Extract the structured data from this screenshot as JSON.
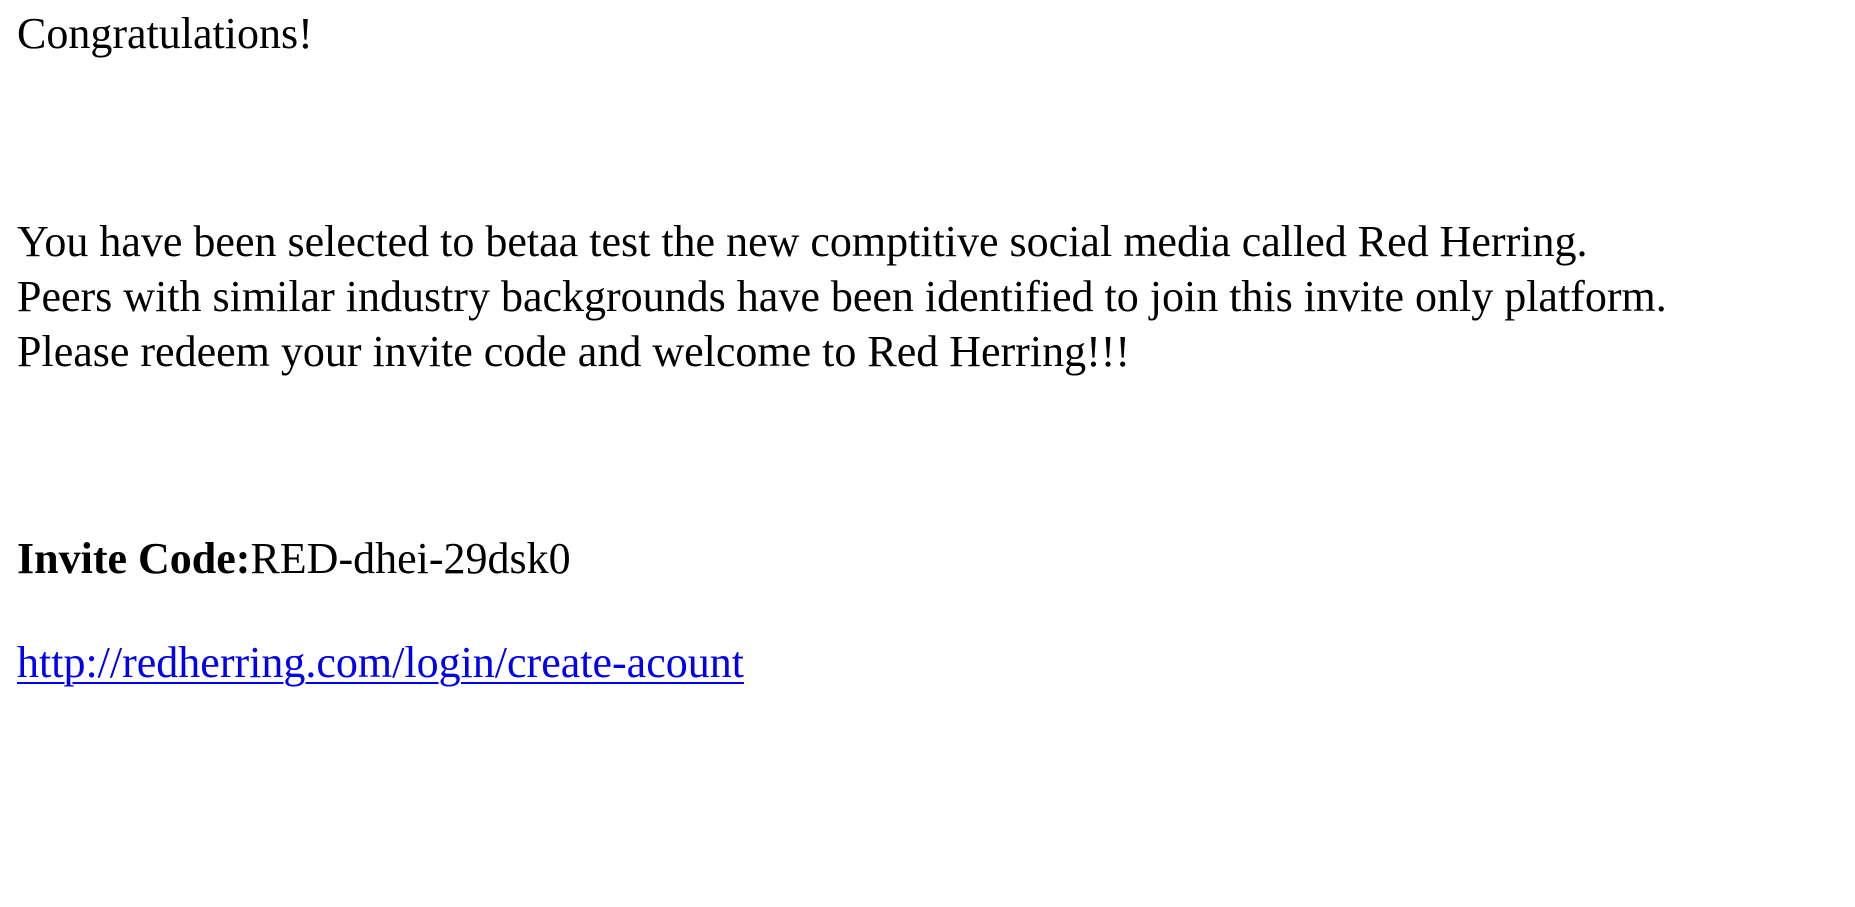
{
  "email": {
    "greeting": "Congratulations!",
    "body_lines": [
      "You have been selected to betaa test the new comptitive social media called Red Herring.",
      "Peers with similar industry backgrounds have been identified to join this invite only platform.",
      "Please redeem your invite code and welcome to Red Herring!!!"
    ],
    "invite": {
      "label": "Invite Code:",
      "code": "RED-dhei-29dsk0"
    },
    "link": {
      "text": "http://redherring.com/login/create-acount",
      "href": "http://redherring.com/login/create-acount"
    }
  },
  "colors": {
    "background": "#ffffff",
    "text": "#000000",
    "link": "#0000ee"
  }
}
